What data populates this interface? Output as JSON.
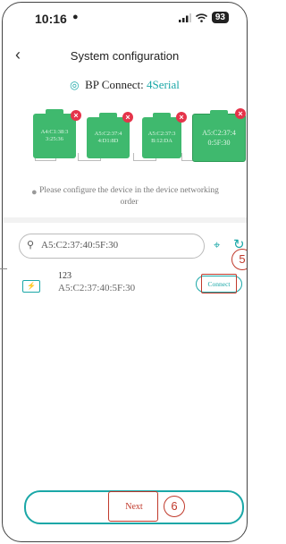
{
  "status_bar": {
    "time": "10:16",
    "person_icon": "person-icon",
    "battery": "93"
  },
  "header": {
    "title": "System configuration",
    "back_icon": "chevron-left-icon"
  },
  "bp": {
    "label": "BP Connect:",
    "value": "4Serial",
    "icon": "signal-icon"
  },
  "batteries": [
    {
      "line1": "A4:C1:38:3",
      "line2": "3:25:36"
    },
    {
      "line1": "A5:C2:37:4",
      "line2": "4:D1:8D"
    },
    {
      "line1": "A5:C2:37:3",
      "line2": "B:12:DA"
    },
    {
      "line1": "A5:C2:37:4",
      "line2": "0:5F:30"
    }
  ],
  "hint": {
    "text": "Please configure the device in the device networking order",
    "icon": "lightbulb-icon"
  },
  "search": {
    "value": "A5:C2:37:40:5F:30",
    "icon": "search-icon"
  },
  "device": {
    "name": "123",
    "mac": "A5:C2:37:40:5F:30",
    "icon": "battery-device-icon"
  },
  "buttons": {
    "connect": "Connect",
    "next": "Next"
  },
  "annotations": {
    "step5": "5",
    "step6": "6"
  },
  "colors": {
    "accent": "#1aa7a7",
    "battery_green": "#3fb96e",
    "badge_red": "#e5344a",
    "annotation_red": "#c0392b"
  }
}
